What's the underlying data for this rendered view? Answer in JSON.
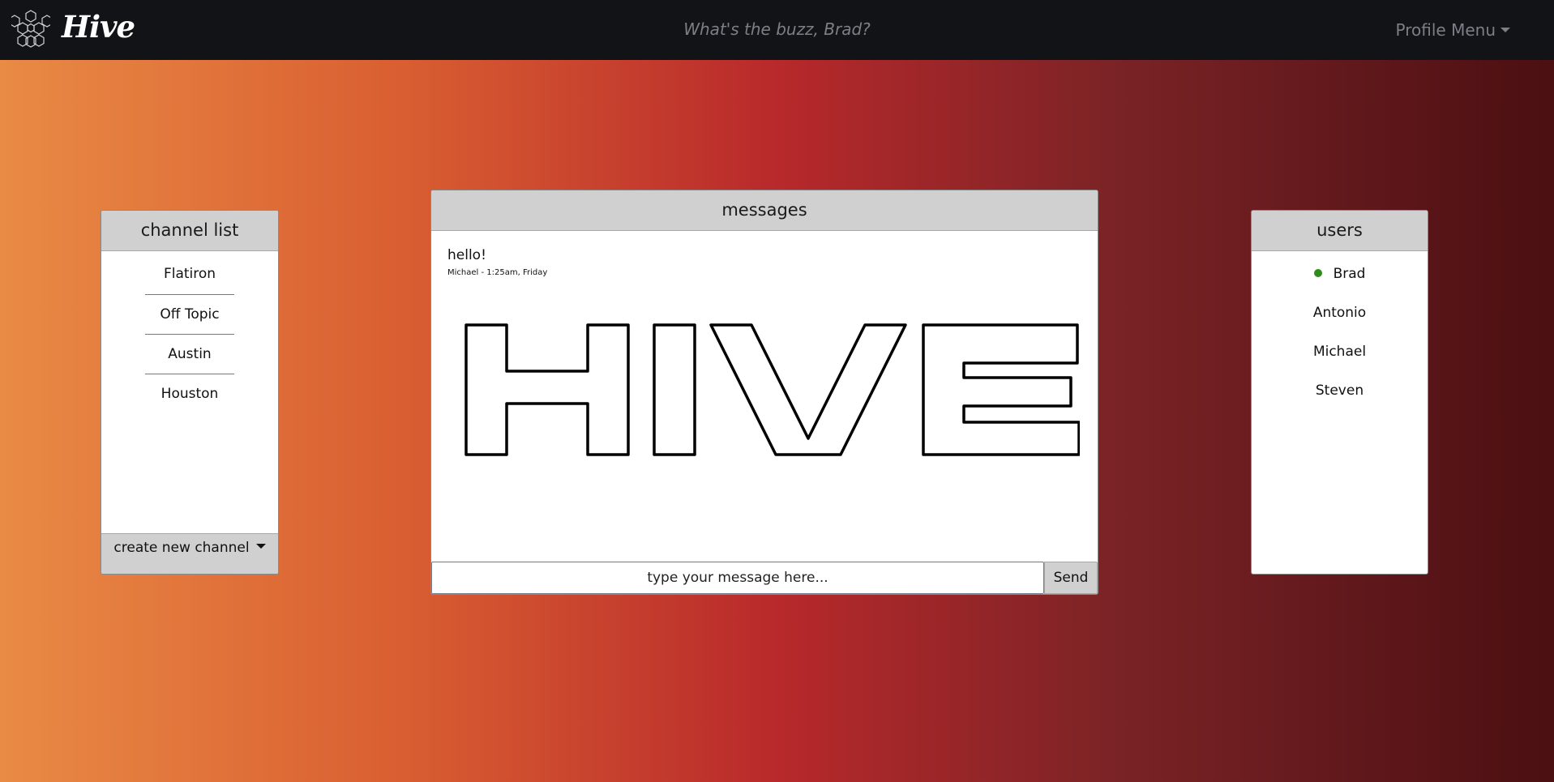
{
  "navbar": {
    "brand": "Hive",
    "buzz_prompt": "What's the buzz, Brad?",
    "profile_menu": "Profile Menu"
  },
  "channels": {
    "title": "channel list",
    "items": [
      {
        "label": "Flatiron"
      },
      {
        "label": "Off Topic"
      },
      {
        "label": "Austin"
      },
      {
        "label": "Houston"
      }
    ],
    "create_label": "create new channel"
  },
  "messages": {
    "title": "messages",
    "list": [
      {
        "text": "hello!",
        "meta": "Michael - 1:25am, Friday"
      }
    ],
    "input_placeholder": "type your message here...",
    "send_label": "Send"
  },
  "users": {
    "title": "users",
    "items": [
      {
        "name": "Brad",
        "online": true
      },
      {
        "name": "Antonio",
        "online": false
      },
      {
        "name": "Michael",
        "online": false
      },
      {
        "name": "Steven",
        "online": false
      }
    ]
  },
  "colors": {
    "navbar": "#111317",
    "panel_header": "#d0d0d0",
    "online": "#2e8b1c",
    "muted_text": "#7b7f86"
  }
}
